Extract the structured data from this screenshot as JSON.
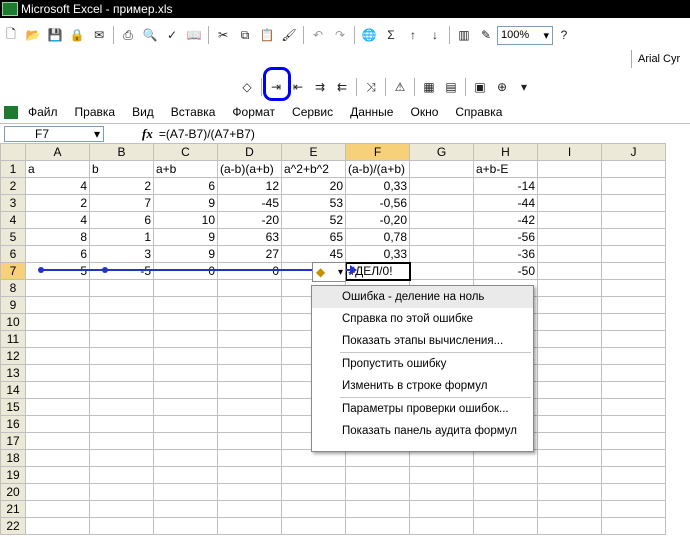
{
  "window": {
    "title": "Microsoft Excel - пример.xls"
  },
  "toolbar": {
    "zoom": "100%",
    "font": "Arial Cyr"
  },
  "menu": [
    "Файл",
    "Правка",
    "Вид",
    "Вставка",
    "Формат",
    "Сервис",
    "Данные",
    "Окно",
    "Справка"
  ],
  "formula_bar": {
    "cell_ref": "F7",
    "fx": "fx",
    "formula": "=(A7-B7)/(A7+B7)"
  },
  "columns": [
    "A",
    "B",
    "C",
    "D",
    "E",
    "F",
    "G",
    "H",
    "I",
    "J"
  ],
  "rows": [
    [
      "a",
      "b",
      "a+b",
      "(a-b)(a+b)",
      "a^2+b^2",
      "(a-b)/(a+b)",
      "",
      "a+b-E",
      "",
      ""
    ],
    [
      "4",
      "2",
      "6",
      "12",
      "20",
      "0,33",
      "",
      "-14",
      "",
      ""
    ],
    [
      "2",
      "7",
      "9",
      "-45",
      "53",
      "-0,56",
      "",
      "-44",
      "",
      ""
    ],
    [
      "4",
      "6",
      "10",
      "-20",
      "52",
      "-0,20",
      "",
      "-42",
      "",
      ""
    ],
    [
      "8",
      "1",
      "9",
      "63",
      "65",
      "0,78",
      "",
      "-56",
      "",
      ""
    ],
    [
      "6",
      "3",
      "9",
      "27",
      "45",
      "0,33",
      "",
      "-36",
      "",
      ""
    ],
    [
      "5",
      "-5",
      "0",
      "0",
      "",
      "#ДЕЛ/0!",
      "",
      "-50",
      "",
      ""
    ]
  ],
  "row_numbers": [
    "1",
    "2",
    "3",
    "4",
    "5",
    "6",
    "7",
    "8",
    "9",
    "10",
    "11",
    "12",
    "13",
    "14",
    "15",
    "16",
    "17",
    "18",
    "19",
    "20",
    "21",
    "22"
  ],
  "error_menu": {
    "items": [
      "Ошибка  - деление на ноль",
      "Справка по этой ошибке",
      "Показать этапы вычисления...",
      "Пропустить ошибку",
      "Изменить в строке формул",
      "Параметры проверки ошибок...",
      "Показать панель аудита формул"
    ]
  },
  "colors": {
    "title_bg": "#000000",
    "header_bg": "#ece9d8",
    "active_header": "#f7d17a",
    "highlight_circle": "#0000ff",
    "tracer": "#2233cc"
  }
}
